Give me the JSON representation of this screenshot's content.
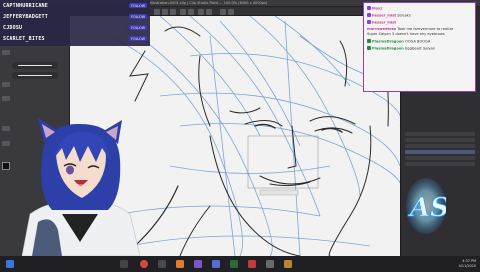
{
  "titlebar": {
    "title": "illustration-0001.clip | Clip Studio Paint  — 100.0% (6000 x 4000px)"
  },
  "followers": [
    {
      "name": "CAPTNHURRICANE",
      "badge": "FOLLOW"
    },
    {
      "name": "JEFFERYBADGETT",
      "badge": "FOLLOW"
    },
    {
      "name": "CJDOSU",
      "badge": "FOLLOW"
    },
    {
      "name": "SCARLET_BITES",
      "badge": "FOLLOW"
    }
  ],
  "chat": {
    "messages": [
      {
        "user": "iFoxz",
        "text": ""
      },
      {
        "user": "hesser_mist",
        "text": "Streaks"
      },
      {
        "user": "hesser_mist",
        "text": ""
      },
      {
        "user": "marcsweetose",
        "text": "Took me forevermore to realize"
      },
      {
        "user": "",
        "text": "Super Saiyan 3 doesn't have any eyebrows"
      },
      {
        "user": "PlasmaDragoon",
        "text": "OOGA BOOGA"
      },
      {
        "user": "PlasmaDragoon",
        "text": "Eggbeast Saiyan"
      }
    ]
  },
  "clock": {
    "time": "4:37 PM",
    "date": "4/11/2020"
  },
  "colors": {
    "accent": "#8a3fd6",
    "follow_bg": "#3c3cb0",
    "username": "#c23a8c",
    "username_alt": "#2a8a3a"
  },
  "logo": {
    "text": "AS"
  }
}
